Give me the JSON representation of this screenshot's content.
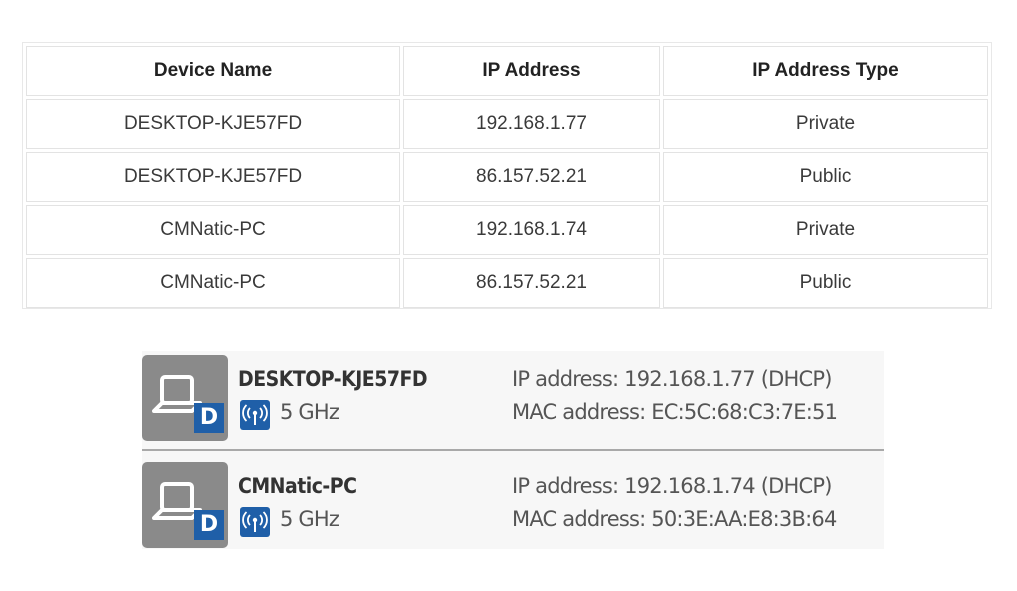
{
  "table": {
    "headers": [
      "Device Name",
      "IP Address",
      "IP Address Type"
    ],
    "rows": [
      [
        "DESKTOP-KJE57FD",
        "192.168.1.77",
        "Private"
      ],
      [
        "DESKTOP-KJE57FD",
        "86.157.52.21",
        "Public"
      ],
      [
        "CMNatic-PC",
        "192.168.1.74",
        "Private"
      ],
      [
        "CMNatic-PC",
        "86.157.52.21",
        "Public"
      ]
    ]
  },
  "devices": [
    {
      "icon": "laptop-icon",
      "badge": "D",
      "name": "DESKTOP-KJE57FD",
      "band_icon": "wifi-signal-icon",
      "band": "5 GHz",
      "ip": "IP address: 192.168.1.77 (DHCP)",
      "mac": "MAC address: EC:5C:68:C3:7E:51"
    },
    {
      "icon": "laptop-icon",
      "badge": "D",
      "name": "CMNatic-PC",
      "band_icon": "wifi-signal-icon",
      "band": "5 GHz",
      "ip": "IP address: 192.168.1.74 (DHCP)",
      "mac": "MAC address: 50:3E:AA:E8:3B:64"
    }
  ],
  "colors": {
    "badge_blue": "#1f5fa8",
    "icon_grey": "#8a8a8a"
  }
}
